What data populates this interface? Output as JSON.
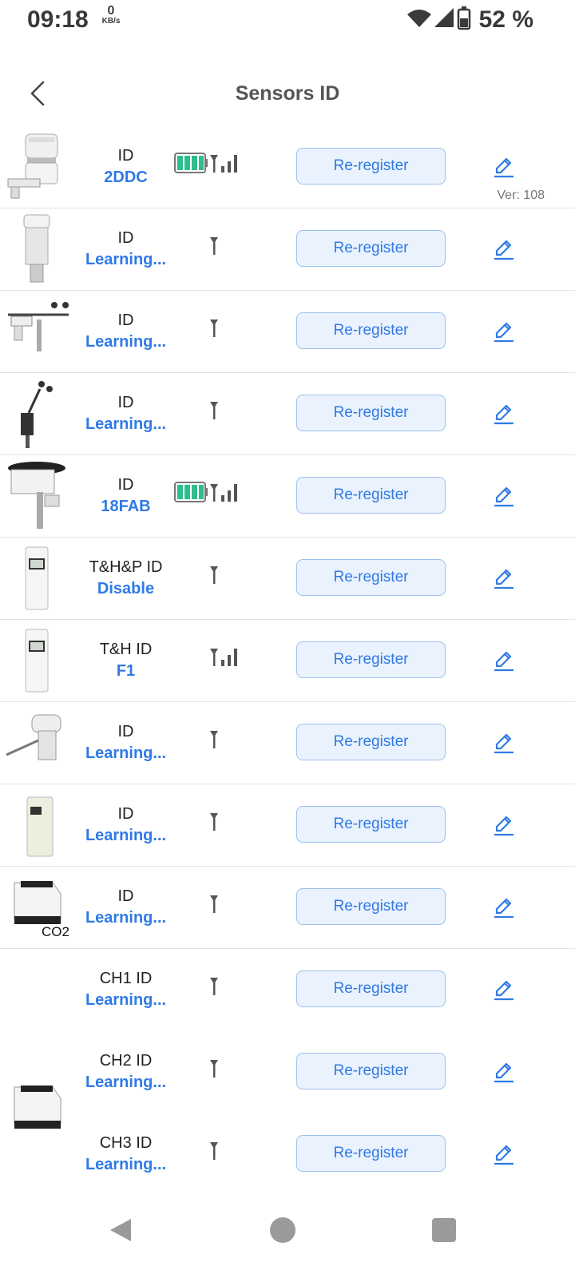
{
  "status": {
    "time": "09:18",
    "speed_value": "0",
    "speed_unit": "KB/s",
    "battery": "52 %"
  },
  "header": {
    "title": "Sensors ID"
  },
  "rereg_label": "Re-register",
  "sensors": [
    {
      "label": "ID",
      "value": "2DDC",
      "signal": "battery-full",
      "version": "Ver: 108"
    },
    {
      "label": "ID",
      "value": "Learning...",
      "signal": "antenna"
    },
    {
      "label": "ID",
      "value": "Learning...",
      "signal": "antenna"
    },
    {
      "label": "ID",
      "value": "Learning...",
      "signal": "antenna"
    },
    {
      "label": "ID",
      "value": "18FAB",
      "signal": "battery-full"
    },
    {
      "label": "T&H&P ID",
      "value": "Disable",
      "signal": "antenna"
    },
    {
      "label": "T&H ID",
      "value": "F1",
      "signal": "bars"
    },
    {
      "label": "ID",
      "value": "Learning...",
      "signal": "antenna"
    },
    {
      "label": "ID",
      "value": "Learning...",
      "signal": "antenna"
    },
    {
      "label": "ID",
      "value": "Learning...",
      "signal": "antenna",
      "badge": "CO2"
    },
    {
      "label": "CH1 ID",
      "value": "Learning...",
      "signal": "antenna"
    },
    {
      "label": "CH2 ID",
      "value": "Learning...",
      "signal": "antenna"
    },
    {
      "label": "CH3 ID",
      "value": "Learning...",
      "signal": "antenna"
    }
  ],
  "colors": {
    "accent": "#2f7ae5",
    "button_bg": "#eaf2fd",
    "battery": "#2dbd8e"
  }
}
